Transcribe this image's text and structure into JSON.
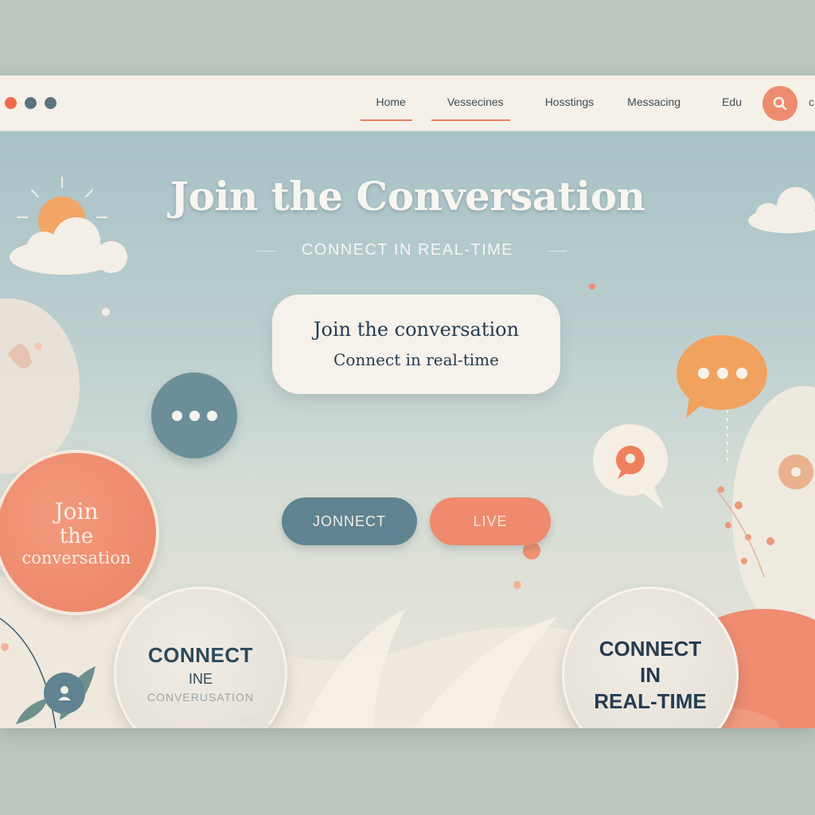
{
  "window": {
    "dot_colors": [
      "#ef6a4a",
      "#5c7480",
      "#5c7480"
    ]
  },
  "nav": {
    "items": [
      {
        "label": "Home",
        "underlined": true
      },
      {
        "label": "Vessecines",
        "underlined": true
      },
      {
        "label": "Hosstings",
        "underlined": false
      },
      {
        "label": "Messacing",
        "underlined": false
      },
      {
        "label": "Edu",
        "underlined": false
      }
    ],
    "search_icon": "search-icon"
  },
  "hero": {
    "title": "Join the Conversation",
    "subtitle": "CONNECT IN REAL-TIME"
  },
  "center_bubble": {
    "line1": "Join the conversation",
    "line2": "Connect in real-time"
  },
  "buttons": {
    "connect_label": "JONNECT",
    "live_label": "LIVE"
  },
  "circle_left": {
    "line1": "Join",
    "line2": "the",
    "line3": "conversation"
  },
  "circle_bottom_left": {
    "line1": "CONNECT",
    "line2": "INE",
    "line3": "CONVERUSATION"
  },
  "circle_bottom_right": {
    "line1": "CONNECT",
    "line2": "IN",
    "line3": "REAL-TIME"
  },
  "colors": {
    "accent_coral": "#ef8a6c",
    "accent_teal": "#5f8390",
    "text_navy": "#243c52",
    "cream": "#f6f1ea"
  }
}
